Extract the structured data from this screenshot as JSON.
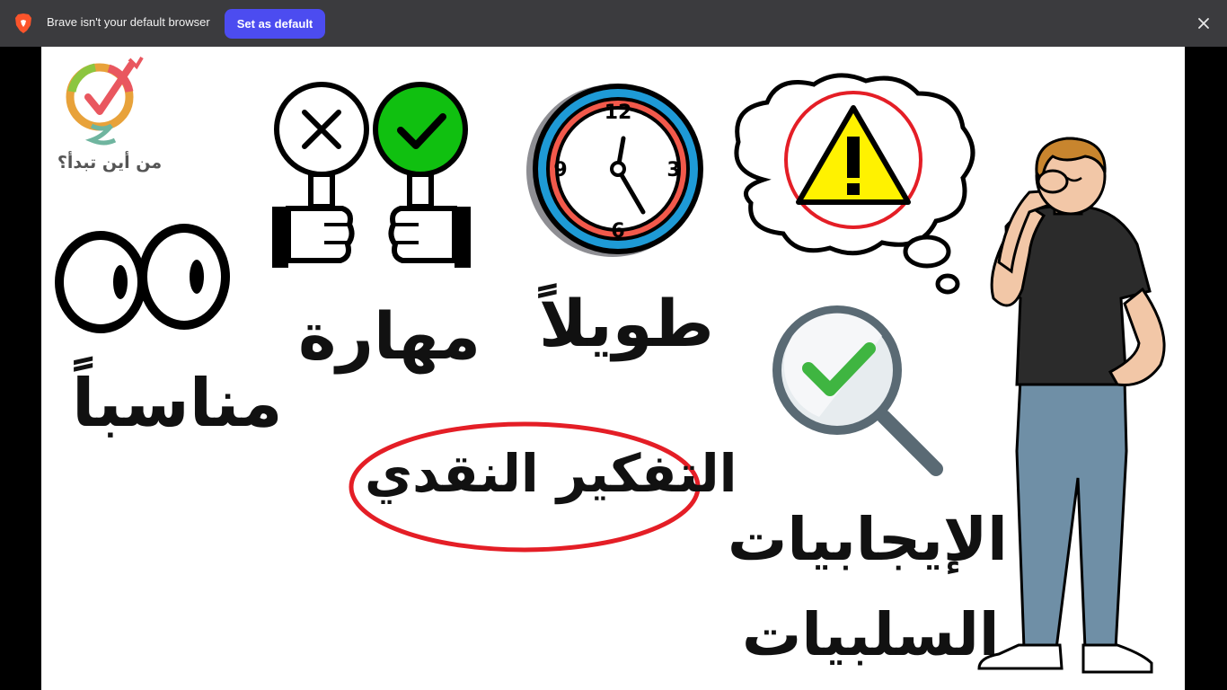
{
  "infobar": {
    "message": "Brave isn't your default browser",
    "set_default_label": "Set as default",
    "accent_color": "#4c4cf0"
  },
  "icons": {
    "brand": "brave-lion-icon",
    "close": "close-icon"
  },
  "slide": {
    "logo_caption": "من أين تبدأ؟",
    "words": {
      "appropriate": "مناسباً",
      "skill": "مهارة",
      "long": "طويلاً",
      "critical_thinking": "التفكير النقدي",
      "positives": "الإيجابيات",
      "negatives": "السلبيات"
    },
    "clock_numbers": [
      "12",
      "3",
      "6",
      "9"
    ],
    "highlight_color": "#e41e26"
  }
}
